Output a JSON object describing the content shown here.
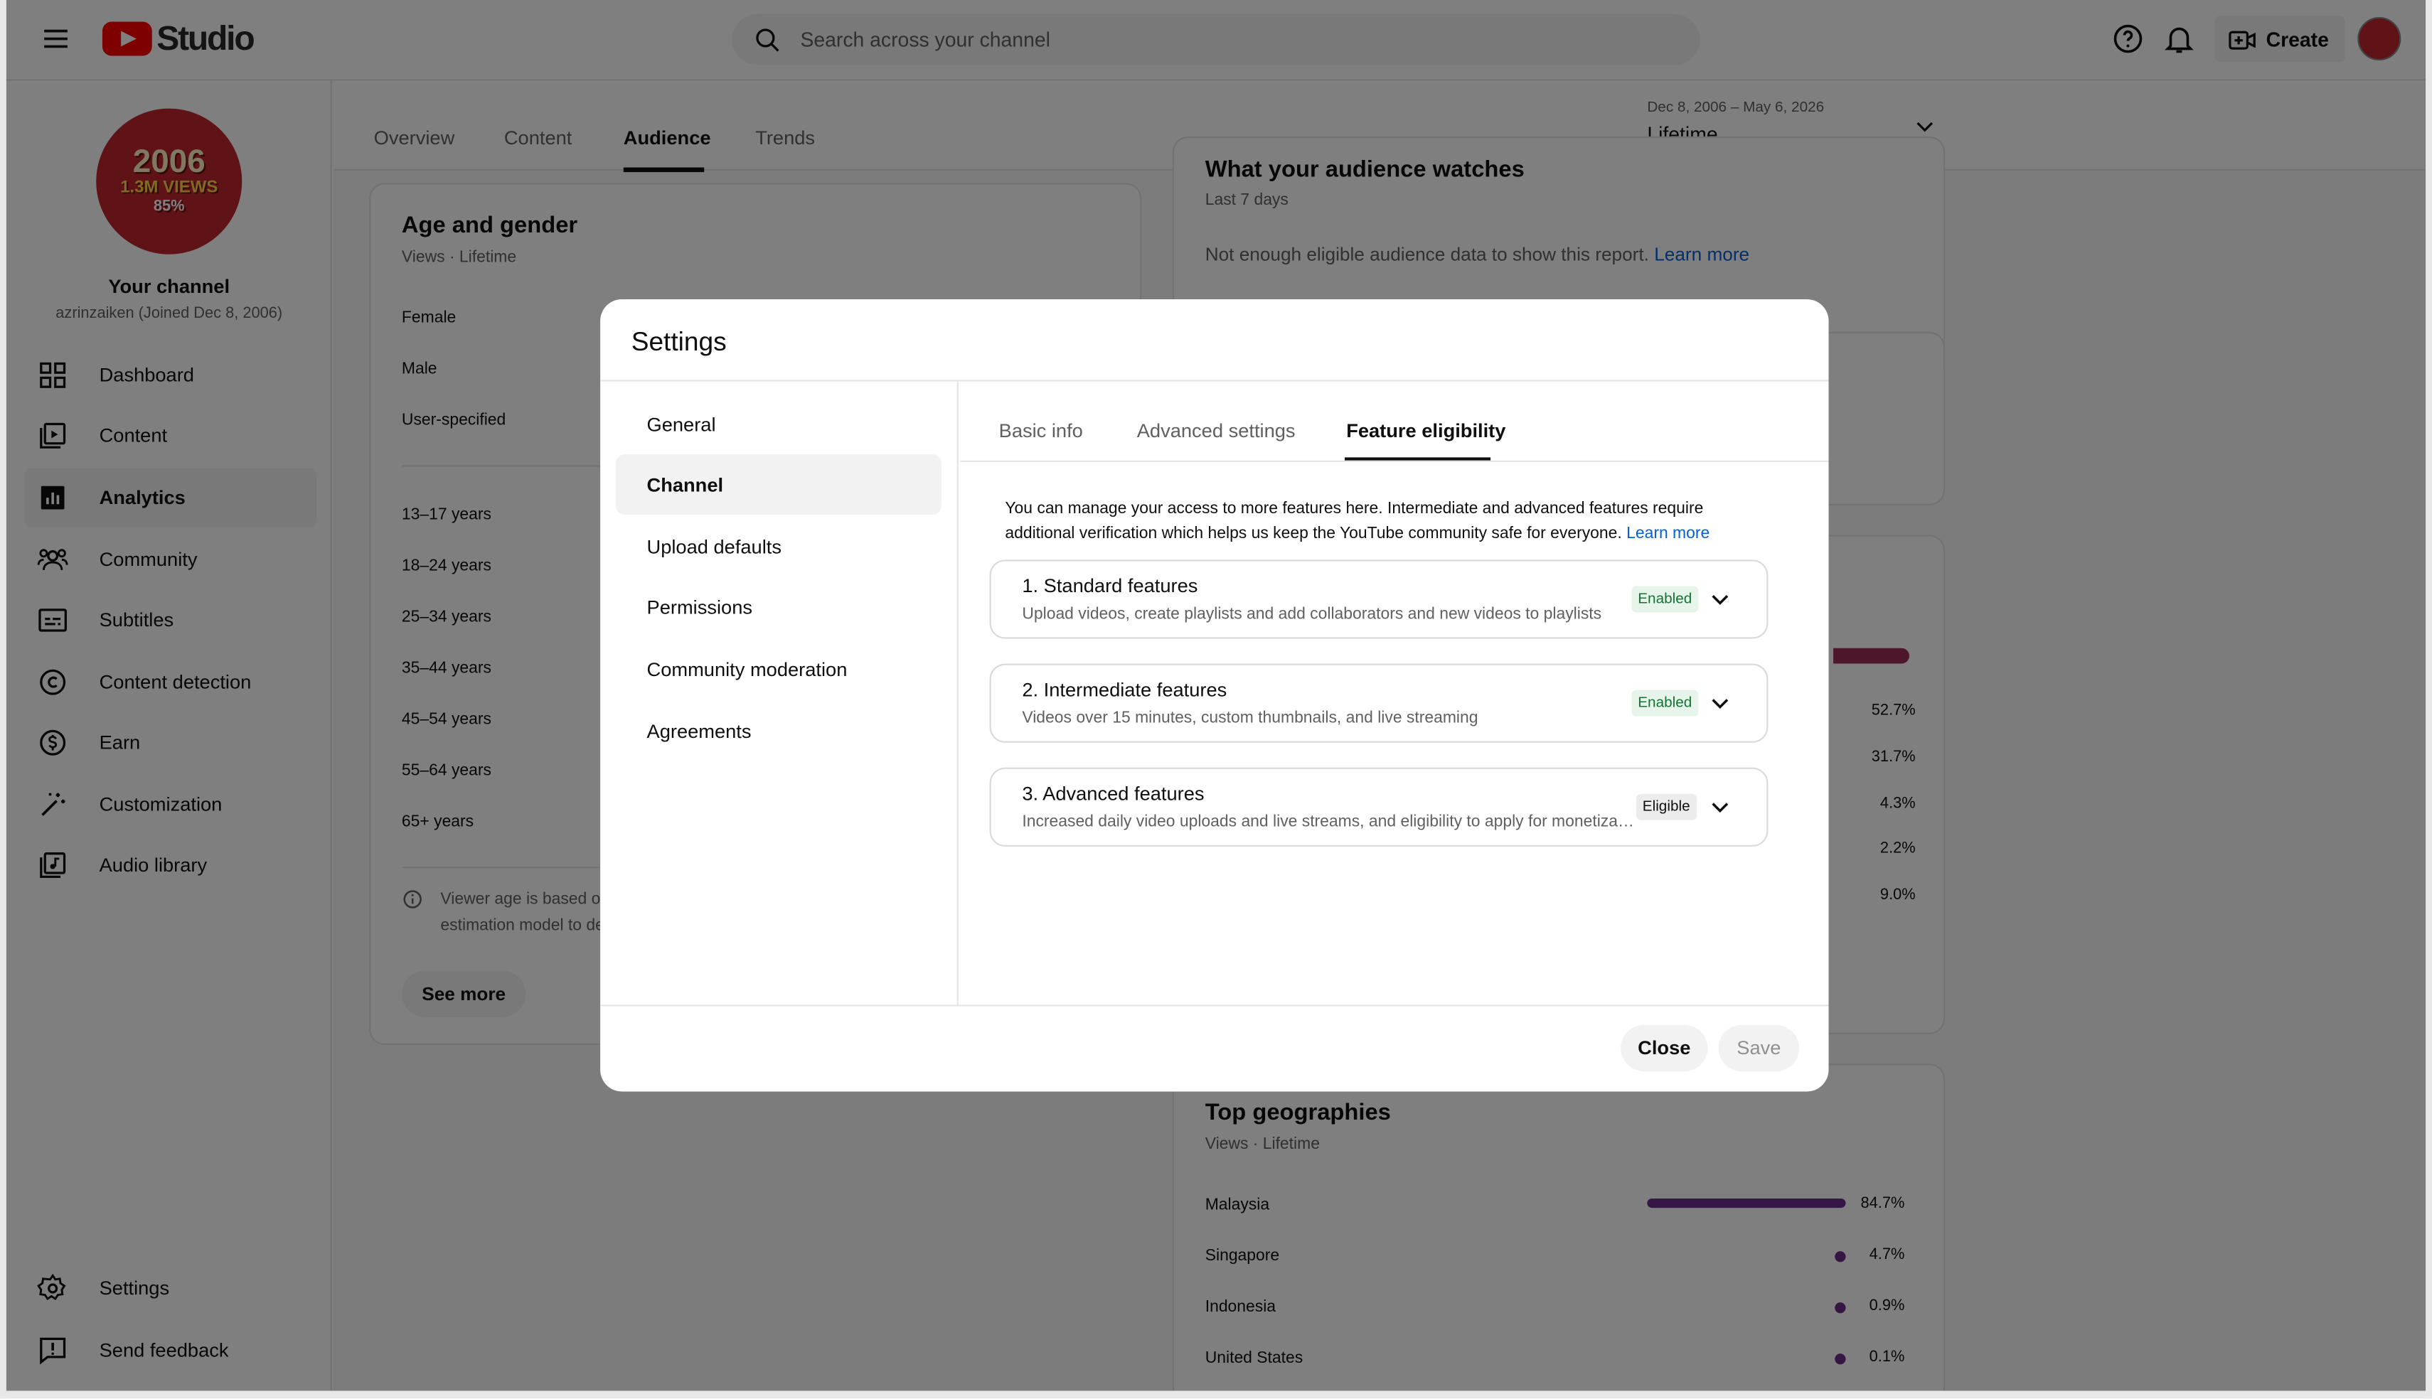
{
  "app": {
    "name": "Studio"
  },
  "search": {
    "placeholder": "Search across your channel"
  },
  "header": {
    "create_label": "Create"
  },
  "channel": {
    "avatar_year": "2006",
    "avatar_views": "1.3M VIEWS",
    "avatar_pct": "85%",
    "name": "Your channel",
    "handle": "azrinzaiken (Joined Dec 8, 2006)"
  },
  "sidebar": {
    "items": [
      {
        "label": "Dashboard",
        "icon": "dashboard-icon"
      },
      {
        "label": "Content",
        "icon": "content-icon"
      },
      {
        "label": "Analytics",
        "icon": "analytics-icon",
        "active": true
      },
      {
        "label": "Community",
        "icon": "community-icon"
      },
      {
        "label": "Subtitles",
        "icon": "subtitles-icon"
      },
      {
        "label": "Content detection",
        "icon": "copyright-icon"
      },
      {
        "label": "Earn",
        "icon": "dollar-icon"
      },
      {
        "label": "Customization",
        "icon": "magic-wand-icon"
      },
      {
        "label": "Audio library",
        "icon": "audio-library-icon"
      }
    ],
    "bottom": [
      {
        "label": "Settings",
        "icon": "gear-icon"
      },
      {
        "label": "Send feedback",
        "icon": "feedback-icon"
      }
    ]
  },
  "analytics": {
    "tabs": [
      "Overview",
      "Content",
      "Audience",
      "Trends"
    ],
    "active_tab": "Audience",
    "date_range": "Dec 8, 2006 – May 6, 2026",
    "date_label": "Lifetime",
    "age_gender": {
      "title": "Age and gender",
      "subtitle": "Views · Lifetime",
      "genders": [
        "Female",
        "Male",
        "User-specified"
      ],
      "ages": [
        "13–17 years",
        "18–24 years",
        "25–34 years",
        "35–44 years",
        "45–54 years",
        "55–64 years",
        "65+ years"
      ],
      "note_line1": "Viewer age is based or",
      "note_line2": "estimation model to de",
      "see_more": "See more"
    },
    "watches": {
      "title_partial": "What your audience watches",
      "subtitle": "Last 7 days",
      "message": "Not enough eligible audience data to show this report.",
      "learn_more": "Learn more"
    },
    "percents": [
      "52.7%",
      "31.7%",
      "4.3%",
      "2.2%",
      "9.0%"
    ],
    "geographies": {
      "title": "Top geographies",
      "subtitle": "Views · Lifetime",
      "rows": [
        {
          "country": "Malaysia",
          "pct": "84.7%",
          "value": 84.7
        },
        {
          "country": "Singapore",
          "pct": "4.7%",
          "value": 4.7
        },
        {
          "country": "Indonesia",
          "pct": "0.9%",
          "value": 0.9
        },
        {
          "country": "United States",
          "pct": "0.1%",
          "value": 0.1
        }
      ]
    }
  },
  "settings_modal": {
    "title": "Settings",
    "nav": [
      "General",
      "Channel",
      "Upload defaults",
      "Permissions",
      "Community moderation",
      "Agreements"
    ],
    "active_nav": "Channel",
    "tabs": [
      "Basic info",
      "Advanced settings",
      "Feature eligibility"
    ],
    "active_tab": "Feature eligibility",
    "description": "You can manage your access to more features here. Intermediate and advanced features require additional verification which helps us keep the YouTube community safe for everyone.",
    "learn_more": "Learn more",
    "features": [
      {
        "title": "1. Standard features",
        "desc": "Upload videos, create playlists and add collaborators and new videos to playlists",
        "status": "Enabled"
      },
      {
        "title": "2. Intermediate features",
        "desc": "Videos over 15 minutes, custom thumbnails, and live streaming",
        "status": "Enabled"
      },
      {
        "title": "3. Advanced features",
        "desc": "Increased daily video uploads and live streams, and eligibility to apply for monetization",
        "status": "Eligible"
      }
    ],
    "close_label": "Close",
    "save_label": "Save"
  },
  "colors": {
    "brand_red": "#ff0000",
    "enabled_green": "#137333",
    "geo_bar": "#6b2c8a",
    "link": "#065fd4"
  }
}
